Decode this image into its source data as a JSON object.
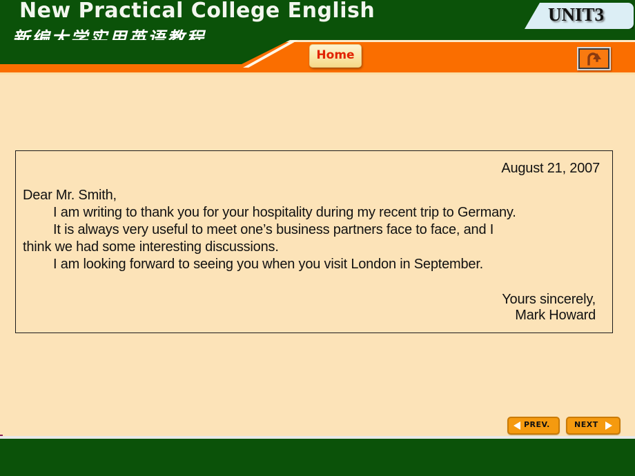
{
  "header": {
    "title_en": "New Practical College English",
    "title_cn": "新编大学实用英语教程",
    "unit_label": "UNIT3",
    "home_label": "Home",
    "return_icon": "return-arrow-icon",
    "colors": {
      "green": "#0B5209",
      "orange": "#FA6E00",
      "banner_blue": "#DCEEF5",
      "home_text_red": "#E12200",
      "page_background": "#FCE3B8"
    }
  },
  "letter": {
    "date": "August 21, 2007",
    "salutation": "Dear Mr. Smith,",
    "body": [
      "I am writing to thank you for your hospitality during my recent trip to Germany.",
      "It is always very useful to meet one’s business partners face to face, and I",
      "think we had some interesting discussions.",
      "I am looking forward to seeing you when you visit London in September."
    ],
    "closing": "Yours sincerely,",
    "signature": "Mark Howard"
  },
  "navigation": {
    "prev_label": "PREV.",
    "next_label": "NEXT",
    "prev_icon": "triangle-left-icon",
    "next_icon": "triangle-right-icon"
  }
}
